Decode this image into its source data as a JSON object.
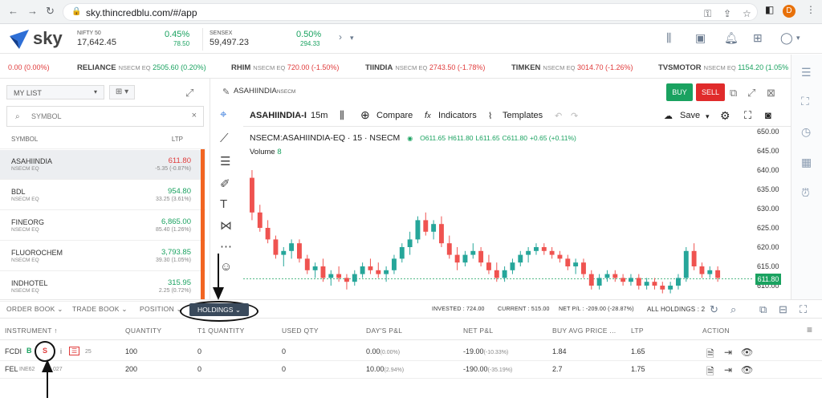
{
  "browser": {
    "url": "sky.thincredblu.com/#/app",
    "avatar_letter": "D"
  },
  "header": {
    "logo": "sky",
    "indices": [
      {
        "name": "NIFTY 50",
        "value": "17,642.45",
        "pct": "0.45%",
        "chg": "78.50"
      },
      {
        "name": "SENSEX",
        "value": "59,497.23",
        "pct": "0.50%",
        "chg": "294.33"
      }
    ]
  },
  "ticker": [
    {
      "sym": "",
      "ex": "",
      "ltp": "0.00 (0.00%)",
      "dir": "red"
    },
    {
      "sym": "RELIANCE",
      "ex": "NSECM EQ",
      "ltp": "2505.60 (0.20%)",
      "dir": "green"
    },
    {
      "sym": "RHIM",
      "ex": "NSECM EQ",
      "ltp": "720.00 (-1.50%)",
      "dir": "red"
    },
    {
      "sym": "TIINDIA",
      "ex": "NSECM EQ",
      "ltp": "2743.50 (-1.78%)",
      "dir": "red"
    },
    {
      "sym": "TIMKEN",
      "ex": "NSECM EQ",
      "ltp": "3014.70 (-1.26%)",
      "dir": "red"
    },
    {
      "sym": "TVSMOTOR",
      "ex": "NSECM EQ",
      "ltp": "1154.20 (1.05%",
      "dir": "green"
    }
  ],
  "watchlist": {
    "list_name": "MY LIST",
    "search_placeholder": "SYMBOL",
    "col_symbol": "SYMBOL",
    "col_ltp": "LTP",
    "rows": [
      {
        "sym": "ASAHIINDIA",
        "ex": "NSECM EQ",
        "ltp": "611.80",
        "chg": "-5.35 (-0.87%)",
        "dir": "red"
      },
      {
        "sym": "BDL",
        "ex": "NSECM EQ",
        "ltp": "954.80",
        "chg": "33.25 (3.61%)",
        "dir": "green"
      },
      {
        "sym": "FINEORG",
        "ex": "NSECM EQ",
        "ltp": "6,865.00",
        "chg": "85.40 (1.26%)",
        "dir": "green"
      },
      {
        "sym": "FLUOROCHEM",
        "ex": "NSECM EQ",
        "ltp": "3,793.85",
        "chg": "39.30 (1.05%)",
        "dir": "green"
      },
      {
        "sym": "INDHOTEL",
        "ex": "NSECM EQ",
        "ltp": "315.95",
        "chg": "2.25 (0.72%)",
        "dir": "green"
      }
    ]
  },
  "chart_panel": {
    "title": "ASAHIINDIA",
    "title_ex": "NSECM",
    "buy": "BUY",
    "sell": "SELL",
    "symbol_short": "ASAHIINDIA-I",
    "interval": "15m",
    "compare": "Compare",
    "indicators": "Indicators",
    "templates": "Templates",
    "save": "Save",
    "legend_symbol": "NSECM:ASAHIINDIA-EQ · 15 · NSECM",
    "o": "O611.65",
    "h": "H611.80",
    "l": "L611.65",
    "c": "C611.80",
    "chg": "+0.65 (+0.11%)",
    "volume_label": "Volume",
    "volume_val": "8",
    "y_ticks": [
      "650.00",
      "645.00",
      "640.00",
      "635.00",
      "630.00",
      "625.00",
      "620.00",
      "615.00",
      "610.00"
    ],
    "last_price": "611.80"
  },
  "chart_data": {
    "type": "candlestick",
    "ylim": [
      608,
      651
    ],
    "y_ticks": [
      650,
      645,
      640,
      635,
      630,
      625,
      620,
      615,
      610
    ],
    "last": 611.8,
    "ohlc": [
      [
        638,
        640,
        627,
        629
      ],
      [
        629,
        631,
        624,
        625
      ],
      [
        625,
        627,
        621,
        622
      ],
      [
        622,
        623,
        617,
        618
      ],
      [
        618,
        620,
        615,
        619
      ],
      [
        619,
        622,
        617,
        621
      ],
      [
        621,
        622,
        616,
        617
      ],
      [
        617,
        618,
        613,
        614
      ],
      [
        614,
        616,
        612,
        615
      ],
      [
        615,
        617,
        611,
        612
      ],
      [
        612,
        614,
        610,
        613
      ],
      [
        613,
        615,
        611,
        612
      ],
      [
        612,
        613,
        609,
        611
      ],
      [
        611,
        614,
        610,
        613
      ],
      [
        613,
        616,
        612,
        615
      ],
      [
        615,
        617,
        613,
        614
      ],
      [
        614,
        616,
        612,
        613
      ],
      [
        613,
        615,
        611,
        614
      ],
      [
        614,
        618,
        613,
        617
      ],
      [
        617,
        621,
        616,
        620
      ],
      [
        620,
        624,
        618,
        622
      ],
      [
        622,
        628,
        621,
        627
      ],
      [
        627,
        629,
        623,
        624
      ],
      [
        624,
        627,
        622,
        626
      ],
      [
        626,
        628,
        620,
        621
      ],
      [
        621,
        623,
        617,
        618
      ],
      [
        618,
        620,
        614,
        616
      ],
      [
        616,
        619,
        615,
        618
      ],
      [
        618,
        621,
        617,
        619
      ],
      [
        619,
        620,
        615,
        616
      ],
      [
        616,
        618,
        613,
        614
      ],
      [
        614,
        616,
        611,
        612
      ],
      [
        612,
        615,
        611,
        614
      ],
      [
        614,
        617,
        613,
        616
      ],
      [
        616,
        619,
        615,
        618
      ],
      [
        618,
        620,
        616,
        619
      ],
      [
        619,
        621,
        618,
        620
      ],
      [
        620,
        621,
        618,
        619
      ],
      [
        619,
        620,
        617,
        618
      ],
      [
        618,
        619,
        616,
        617
      ],
      [
        617,
        618,
        614,
        615
      ],
      [
        615,
        617,
        613,
        616
      ],
      [
        616,
        617,
        612,
        613
      ],
      [
        613,
        614,
        609,
        610
      ],
      [
        610,
        613,
        609,
        612
      ],
      [
        612,
        614,
        611,
        613
      ],
      [
        613,
        614,
        611,
        612
      ],
      [
        612,
        613,
        610,
        611
      ],
      [
        611,
        613,
        610,
        612
      ],
      [
        612,
        613,
        609,
        610
      ],
      [
        610,
        612,
        609,
        611
      ],
      [
        611,
        612,
        609,
        610
      ],
      [
        610,
        611,
        608,
        609
      ],
      [
        609,
        611,
        608,
        610
      ],
      [
        610,
        613,
        609,
        612
      ],
      [
        612,
        620,
        611,
        619
      ],
      [
        619,
        621,
        614,
        615
      ],
      [
        615,
        616,
        612,
        613
      ],
      [
        613,
        615,
        612,
        614
      ],
      [
        614,
        615,
        611,
        612
      ]
    ]
  },
  "bottom": {
    "tabs": [
      "ORDER BOOK",
      "TRADE BOOK",
      "POSITION",
      "HOLDINGS"
    ],
    "invested": "INVESTED : 724.00",
    "current": "CURRENT : 515.00",
    "net": "NET P/L : -209.00 (-28.87%)",
    "all": "ALL HOLDINGS : 2",
    "columns": [
      "INSTRUMENT ↑",
      "QUANTITY",
      "T1 QUANTITY",
      "USED QTY",
      "DAY'S P&L",
      "NET P&L",
      "BUY AVG PRICE ...",
      "LTP",
      "ACTION"
    ],
    "rows": [
      {
        "inst": "FCDI",
        "isin": "25",
        "qty": "100",
        "t1": "0",
        "used": "0",
        "day": "0.00",
        "day_pct": "(0.00%)",
        "net": "-19.00",
        "net_pct": "(-10.33%)",
        "avg": "1.84",
        "ltp": "1.65"
      },
      {
        "inst": "FEL",
        "isin": "INE62",
        "isin2": "027",
        "qty": "200",
        "t1": "0",
        "used": "0",
        "day": "10.00",
        "day_pct": "(2.94%)",
        "net": "-190.00",
        "net_pct": "(-35.19%)",
        "avg": "2.7",
        "ltp": "1.75"
      }
    ],
    "b_label": "B",
    "s_label": "S",
    "i_label": "i"
  }
}
